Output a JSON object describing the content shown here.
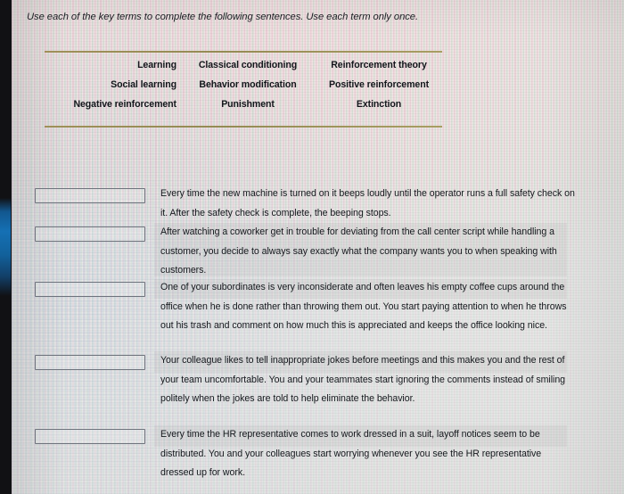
{
  "instruction": "Use each of the key terms to complete the following sentences. Use each term only once.",
  "key_terms": {
    "columns": [
      [
        "Learning",
        "Social learning",
        "Negative reinforcement"
      ],
      [
        "Classical conditioning",
        "Behavior modification",
        "Punishment"
      ],
      [
        "Reinforcement theory",
        "Positive reinforcement",
        "Extinction"
      ]
    ],
    "rule_color": "#8e8448"
  },
  "questions": [
    {
      "answer": "",
      "text": "Every time the new machine is turned on it beeps loudly until the operator runs a full safety check on it. After the safety check is complete, the beeping stops."
    },
    {
      "answer": "",
      "text": "After watching a coworker get in trouble for deviating from the call center script while handling a customer, you decide to always say exactly what the company wants you to when speaking with customers."
    },
    {
      "answer": "",
      "text": "One of your subordinates is very inconsiderate and often leaves his empty coffee cups around the office when he is done rather than throwing them out. You start paying attention to when he throws out his trash and comment on how much this is appreciated and keeps the office looking nice."
    },
    {
      "answer": "",
      "text": "Your colleague likes to tell inappropriate jokes before meetings and this makes you and the rest of your team uncomfortable. You and your teammates start ignoring the comments instead of smiling politely when the jokes are told to help eliminate the behavior."
    },
    {
      "answer": "",
      "text": "Every time the HR representative comes to work dressed in a suit, layoff notices seem to be distributed. You and your colleagues start worrying whenever you see the HR representative dressed up for work."
    }
  ]
}
